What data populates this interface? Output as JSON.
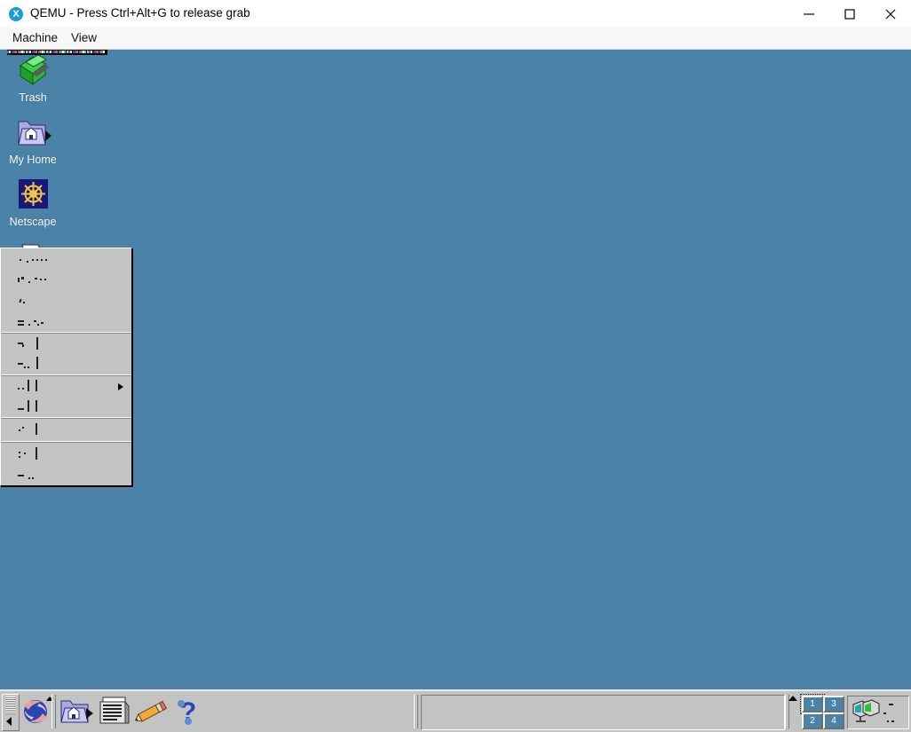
{
  "host_window": {
    "title": "QEMU - Press Ctrl+Alt+G to release grab",
    "app_icon": "qemu-x-icon",
    "controls": {
      "minimize": "minimize-icon",
      "maximize": "maximize-icon",
      "close": "close-icon"
    },
    "menubar": [
      {
        "label": "Machine"
      },
      {
        "label": "View"
      }
    ]
  },
  "guest_desktop": {
    "background_color": "#4a82a8",
    "icons": [
      {
        "label": "Trash",
        "icon": "trash-bin-icon"
      },
      {
        "label": "My Home",
        "icon": "home-folder-icon"
      },
      {
        "label": "Netscape",
        "icon": "netscape-ships-wheel-icon"
      },
      {
        "label": "",
        "icon": "printer-icon"
      }
    ],
    "context_menu": {
      "note": "Open popup menu; glyphs are only partially rendered by the guest",
      "sections": [
        {
          "items": [
            {
              "label": ""
            },
            {
              "label": ""
            },
            {
              "label": ""
            },
            {
              "label": ""
            }
          ]
        },
        {
          "items": [
            {
              "label": ""
            },
            {
              "label": ""
            }
          ]
        },
        {
          "items": [
            {
              "label": "",
              "submenu_arrow": "▶"
            },
            {
              "label": ""
            }
          ]
        },
        {
          "items": [
            {
              "label": ""
            }
          ]
        },
        {
          "items": [
            {
              "label": ""
            },
            {
              "label": ""
            }
          ]
        }
      ]
    },
    "taskbar": {
      "collapse_handle": "collapse-left-icon",
      "buttons": [
        {
          "name": "k-menu",
          "icon": "globe-icon"
        },
        {
          "name": "home",
          "icon": "home-folder-icon"
        },
        {
          "name": "terminal",
          "icon": "terminal-icon"
        },
        {
          "name": "editor",
          "icon": "pencil-icon"
        },
        {
          "name": "help",
          "icon": "question-mark-icon"
        }
      ],
      "tasklist_items": [],
      "pager": {
        "desktops": [
          {
            "label": "1",
            "active": true
          },
          {
            "label": "3",
            "active": false
          },
          {
            "label": "2",
            "active": false
          },
          {
            "label": "4",
            "active": false
          }
        ]
      },
      "tray": {
        "icon": "dual-monitor-icon"
      }
    }
  }
}
